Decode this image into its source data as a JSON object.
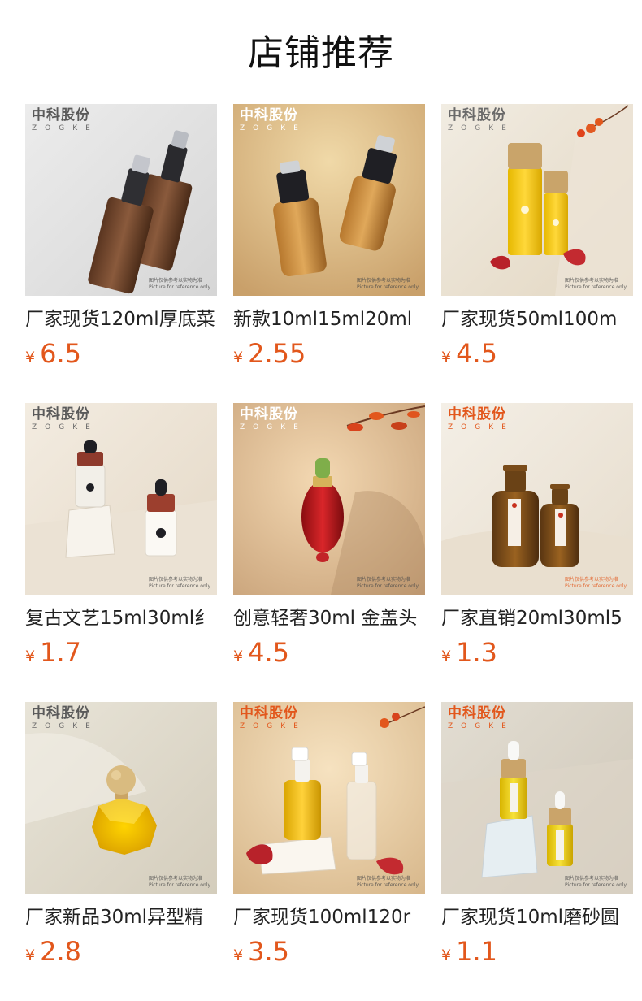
{
  "page": {
    "title": "店铺推荐",
    "accent_color": "#e2571c"
  },
  "brand": {
    "name_cn": "中科股份",
    "name_en": "ZOGKE",
    "disclaimer_cn": "图片仅供参考以实物为准",
    "disclaimer_en": "Picture for reference only"
  },
  "products": [
    {
      "name": "厂家现货120ml厚底菜",
      "currency": "¥",
      "price": "6.5",
      "image": "two-brown-pump-bottles"
    },
    {
      "name": "新款10ml15ml20ml",
      "currency": "¥",
      "price": "2.55",
      "image": "two-gold-pump-bottles"
    },
    {
      "name": "厂家现货50ml100m",
      "currency": "¥",
      "price": "4.5",
      "image": "two-yellow-bamboo-cap-bottles"
    },
    {
      "name": "复古文艺15ml30ml纟",
      "currency": "¥",
      "price": "1.7",
      "image": "two-white-dropper-bottles"
    },
    {
      "name": "创意轻奢30ml 金盖头",
      "currency": "¥",
      "price": "4.5",
      "image": "red-dropper-bottle"
    },
    {
      "name": "厂家直销20ml30ml5",
      "currency": "¥",
      "price": "1.3",
      "image": "two-amber-bottles"
    },
    {
      "name": "厂家新品30ml异型精",
      "currency": "¥",
      "price": "2.8",
      "image": "faceted-yellow-bottle"
    },
    {
      "name": "厂家现货100ml120r",
      "currency": "¥",
      "price": "3.5",
      "image": "two-spray-bottles"
    },
    {
      "name": "厂家现货10ml磨砂圆",
      "currency": "¥",
      "price": "1.1",
      "image": "two-frosted-dropper-bottles"
    }
  ]
}
